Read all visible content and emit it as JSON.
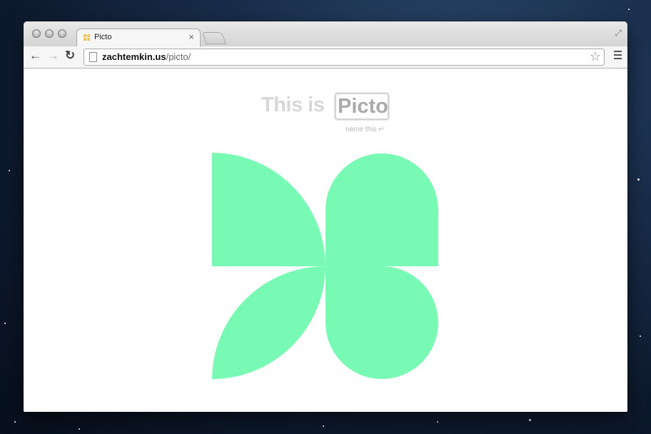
{
  "browser": {
    "tab_title": "Picto",
    "tab_close": "×",
    "url_host": "zachtemkin.us",
    "url_path": "/picto/",
    "back_icon": "←",
    "forward_icon": "→",
    "reload_icon": "↻",
    "star_icon": "☆",
    "fullscreen_icon": "⤢"
  },
  "page": {
    "headline_prefix": "This is",
    "name_value": "Picto",
    "hint_text": "name this ↵"
  },
  "colors": {
    "logo_green": "#78f9b4",
    "headline_gray": "#d7d7d7"
  }
}
